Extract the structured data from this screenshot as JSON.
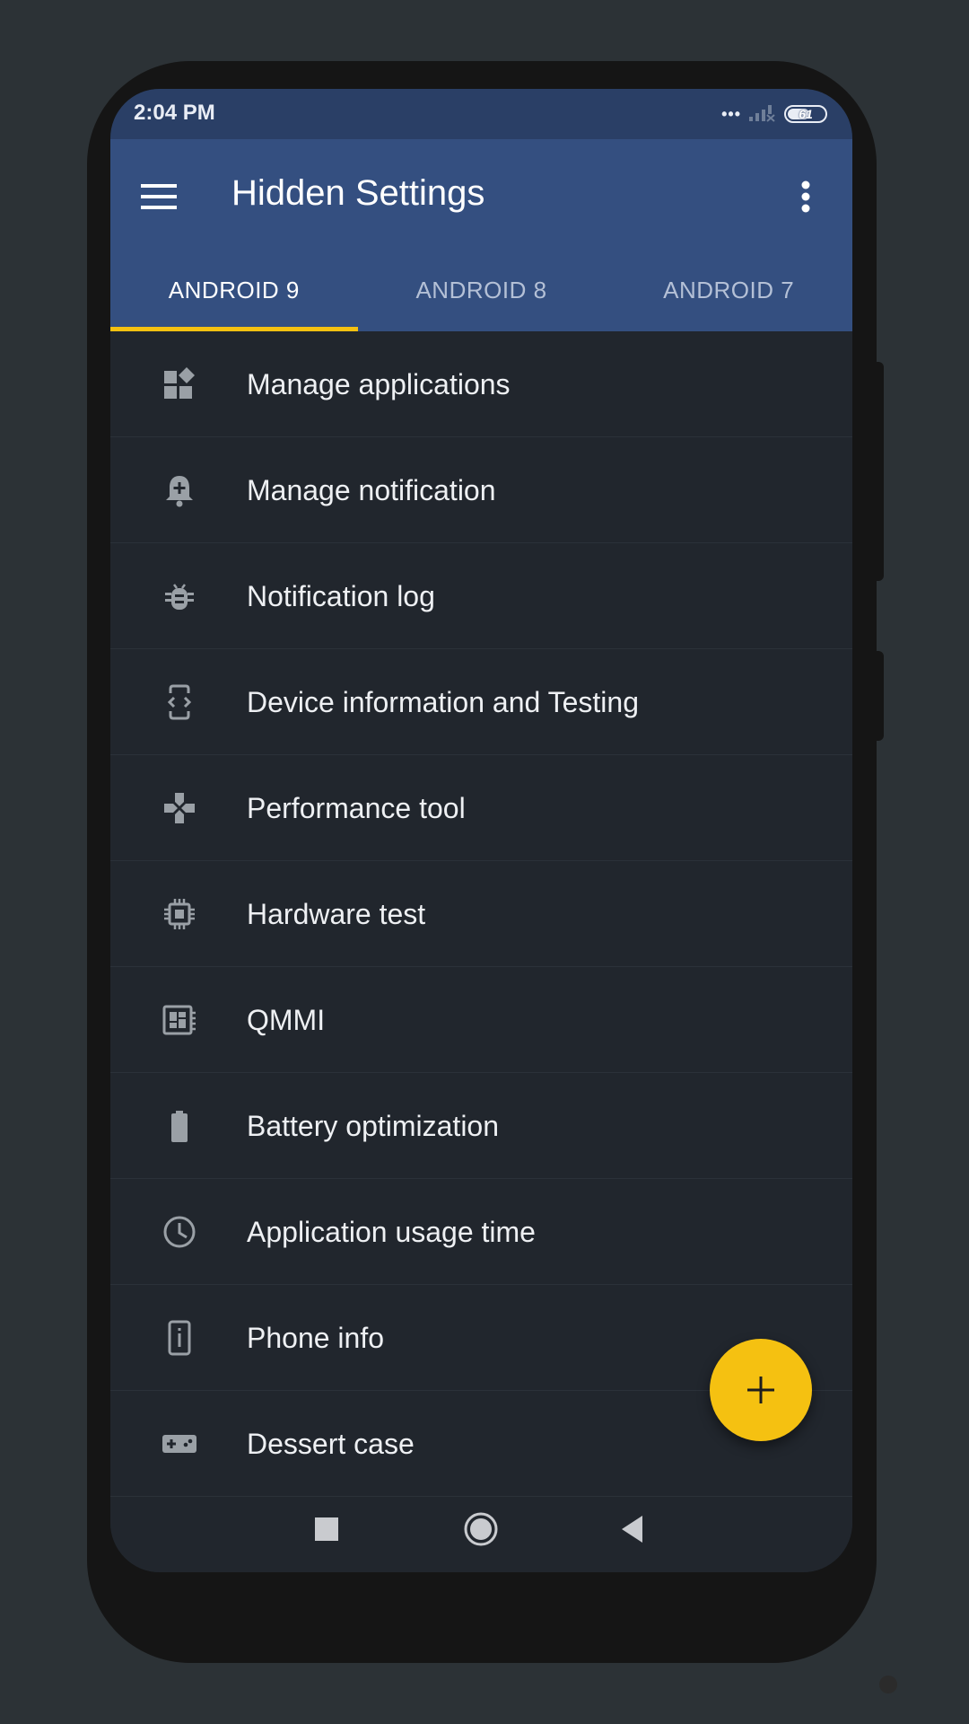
{
  "status_bar": {
    "time": "2:04 PM",
    "battery_level": "61",
    "icons": [
      "dots-icon",
      "signal-icon",
      "battery-icon"
    ]
  },
  "app_bar": {
    "title": "Hidden Settings",
    "menu_icon": "hamburger-menu-icon",
    "overflow_icon": "more-vertical-icon"
  },
  "tabs": [
    {
      "label": "ANDROID 9",
      "active": true
    },
    {
      "label": "ANDROID 8",
      "active": false
    },
    {
      "label": "ANDROID 7",
      "active": false
    }
  ],
  "items": [
    {
      "label": "Manage applications",
      "icon": "widgets-icon"
    },
    {
      "label": "Manage notification",
      "icon": "notification-add-icon"
    },
    {
      "label": "Notification log",
      "icon": "bug-icon"
    },
    {
      "label": "Device information and Testing",
      "icon": "developer-mode-icon"
    },
    {
      "label": "Performance tool",
      "icon": "gamepad-icon"
    },
    {
      "label": "Hardware test",
      "icon": "chip-icon"
    },
    {
      "label": "QMMI",
      "icon": "dashboard-icon"
    },
    {
      "label": "Battery optimization",
      "icon": "battery-icon"
    },
    {
      "label": "Application usage time",
      "icon": "clock-icon"
    },
    {
      "label": "Phone info",
      "icon": "phone-info-icon"
    },
    {
      "label": "Dessert case",
      "icon": "game-controller-icon"
    }
  ],
  "fab": {
    "icon": "plus-icon"
  },
  "nav_bar": {
    "icons": [
      "recents-square-icon",
      "home-circle-icon",
      "back-triangle-icon"
    ]
  },
  "colors": {
    "background": "#2c3236",
    "status_bar": "#2a3f66",
    "app_bar": "#344f80",
    "list_background": "#21262d",
    "accent": "#f5c111",
    "icon_gray": "#9aa0a6"
  }
}
